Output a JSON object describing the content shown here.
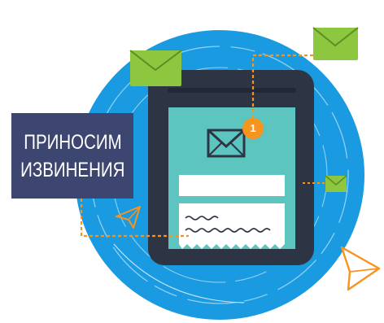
{
  "banner": {
    "line1": "ПРИНОСИМ",
    "line2": "ИЗВИНЕНИЯ"
  },
  "notification": {
    "count": "1"
  },
  "icons": {
    "envelope": "envelope-icon",
    "paper_plane": "paper-plane-icon",
    "phone": "smartphone-icon"
  },
  "colors": {
    "circle_blue": "#1a9ae0",
    "phone_dark": "#2d3545",
    "screen_teal": "#5cc5c0",
    "envelope_green": "#8dc63f",
    "badge_orange": "#f7941d",
    "banner_navy": "#3c4670"
  }
}
